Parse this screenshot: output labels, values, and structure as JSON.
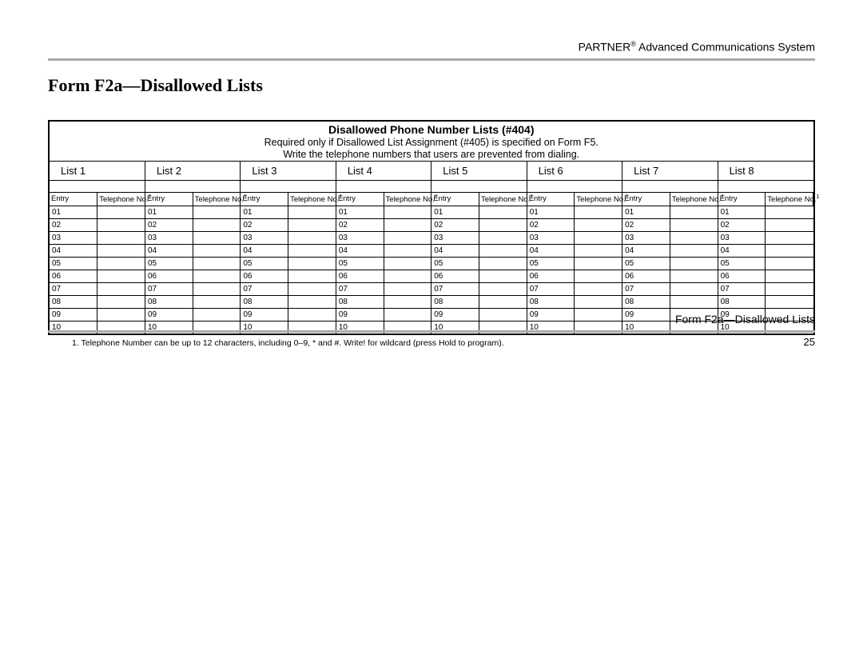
{
  "header": {
    "brand": "PARTNER",
    "reg": "®",
    "system": " Advanced Communications System"
  },
  "title": "Form F2a—Disallowed Lists",
  "table": {
    "title": "Disallowed Phone Number Lists (#404)",
    "sub1": "Required only if Disallowed List Assignment (#405) is specified on Form F5.",
    "sub2": "Write the telephone numbers that users are prevented from dialing.",
    "list_labels": [
      "List 1",
      "List 2",
      "List 3",
      "List 4",
      "List 5",
      "List 6",
      "List 7",
      "List 8"
    ],
    "col_entry": "Entry",
    "col_tel": "Telephone No.",
    "col_sup": "1",
    "rows": [
      "01",
      "02",
      "03",
      "04",
      "05",
      "06",
      "07",
      "08",
      "09",
      "10"
    ]
  },
  "footnote": "1.  Telephone Number can be up to 12 characters, including 0–9, * and #. Write! for wildcard (press Hold to program).",
  "footer": {
    "label": "Form F2a—Disallowed Lists",
    "page": "25"
  }
}
